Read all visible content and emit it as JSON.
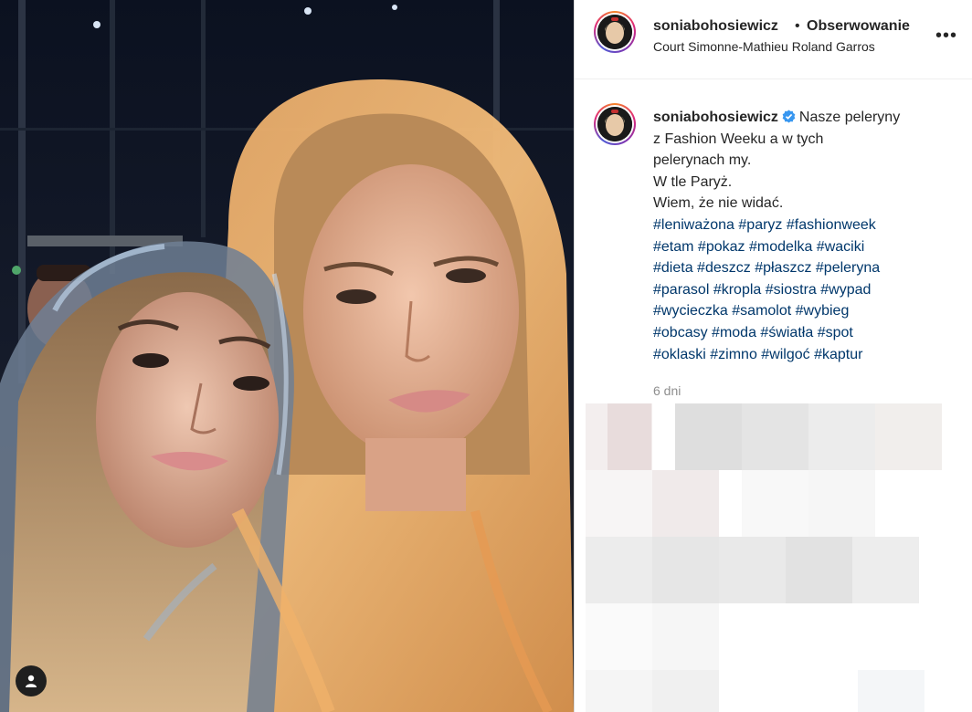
{
  "post": {
    "username": "soniabohosiewicz",
    "separator": "•",
    "follow_status": "Obserwowanie",
    "location": "Court Simonne-Mathieu Roland Garros",
    "more_label": "•••",
    "verified_icon": "verified-badge-icon",
    "caption_lines": [
      "Nasze peleryny",
      "z Fashion Weeku a w tych",
      "pelerynach my.",
      "W tle Paryż.",
      "Wiem, że nie widać."
    ],
    "hashtag_lines": [
      [
        "#leniważona",
        "#paryz",
        "#fashionweek"
      ],
      [
        "#etam",
        "#pokaz",
        "#modelka",
        "#waciki"
      ],
      [
        "#dieta",
        "#deszcz",
        "#płaszcz",
        "#peleryna"
      ],
      [
        "#parasol",
        "#kropla",
        "#siostra",
        "#wypad"
      ],
      [
        "#wycieczka",
        "#samolot",
        "#wybieg"
      ],
      [
        "#obcasy",
        "#moda",
        "#światła",
        "#spot"
      ],
      [
        "#oklaski",
        "#zimno",
        "#wilgoć",
        "#kaptur"
      ]
    ],
    "timestamp": "6 dni"
  },
  "colors": {
    "link": "#00376b",
    "verified": "#3897f0",
    "text": "#262626",
    "muted": "#8e8e8e"
  }
}
